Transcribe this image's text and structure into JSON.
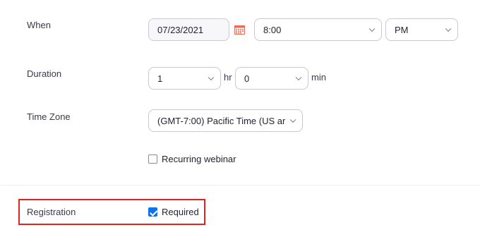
{
  "when": {
    "label": "When",
    "date": "07/23/2021",
    "time": "8:00",
    "ampm": "PM"
  },
  "duration": {
    "label": "Duration",
    "hours": "1",
    "hours_unit": "hr",
    "minutes": "0",
    "minutes_unit": "min"
  },
  "timezone": {
    "label": "Time Zone",
    "value": "(GMT-7:00) Pacific Time (US ar"
  },
  "recurring": {
    "label": "Recurring webinar",
    "checked": false
  },
  "registration": {
    "label": "Registration",
    "option_label": "Required",
    "checked": true
  },
  "colors": {
    "accent": "#0e72ed",
    "highlight": "#e0231c"
  },
  "icons": {
    "calendar": "calendar-icon",
    "dropdown": "chevron-down-icon"
  }
}
